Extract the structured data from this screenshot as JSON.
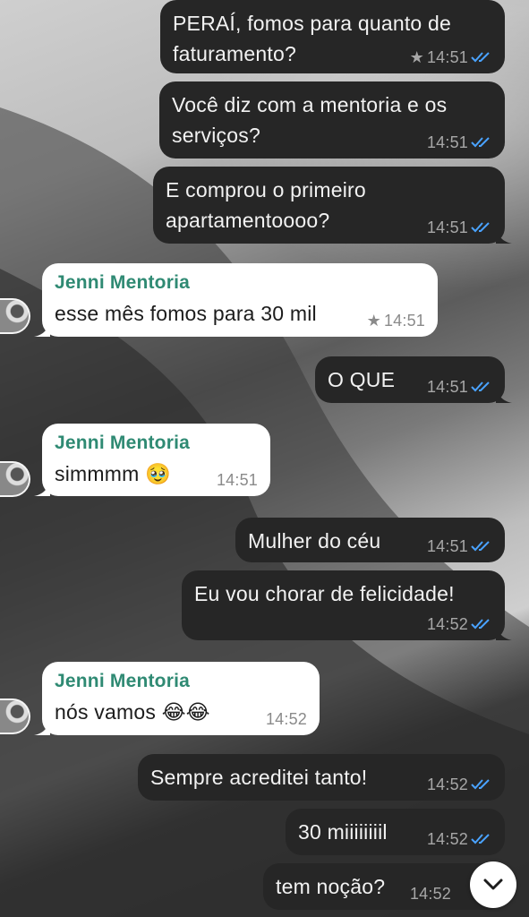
{
  "messages": [
    {
      "id": 1,
      "dir": "out",
      "text": "PERAÍ, fomos para quanto de faturamento?",
      "time": "14:51",
      "starred": true
    },
    {
      "id": 2,
      "dir": "out",
      "text": "Você diz com a mentoria e os serviços?",
      "time": "14:51",
      "starred": false
    },
    {
      "id": 3,
      "dir": "out",
      "text": "E comprou o primeiro apartamentoooo?",
      "time": "14:51",
      "starred": false
    },
    {
      "id": 4,
      "dir": "in",
      "sender": "Jenni Mentoria",
      "text": "esse mês fomos para 30 mil",
      "time": "14:51",
      "starred": true
    },
    {
      "id": 5,
      "dir": "out",
      "text": "O QUE",
      "time": "14:51",
      "starred": false
    },
    {
      "id": 6,
      "dir": "in",
      "sender": "Jenni Mentoria",
      "text": "simmmm 🥹",
      "time": "14:51",
      "starred": false
    },
    {
      "id": 7,
      "dir": "out",
      "text": "Mulher do céu",
      "time": "14:51",
      "starred": false
    },
    {
      "id": 8,
      "dir": "out",
      "text": "Eu vou chorar de felicidade!",
      "time": "14:52",
      "starred": false
    },
    {
      "id": 9,
      "dir": "in",
      "sender": "Jenni Mentoria",
      "text": "nós vamos 😂😂",
      "time": "14:52",
      "starred": false
    },
    {
      "id": 10,
      "dir": "out",
      "text": "Sempre acreditei tanto!",
      "time": "14:52",
      "starred": false
    },
    {
      "id": 11,
      "dir": "out",
      "text": "30 miiiiiiiil",
      "time": "14:52",
      "starred": false
    },
    {
      "id": 12,
      "dir": "out",
      "text": "tem noção?",
      "time": "14:52",
      "starred": false
    }
  ],
  "icons": {
    "read_receipt": "double-check-icon",
    "star": "star-icon",
    "scroll_down": "chevron-down-icon"
  },
  "colors": {
    "outgoing_bubble": "#262626",
    "incoming_bubble": "#ffffff",
    "sender_name": "#2f8a73",
    "read_tick": "#4aa3ff"
  }
}
